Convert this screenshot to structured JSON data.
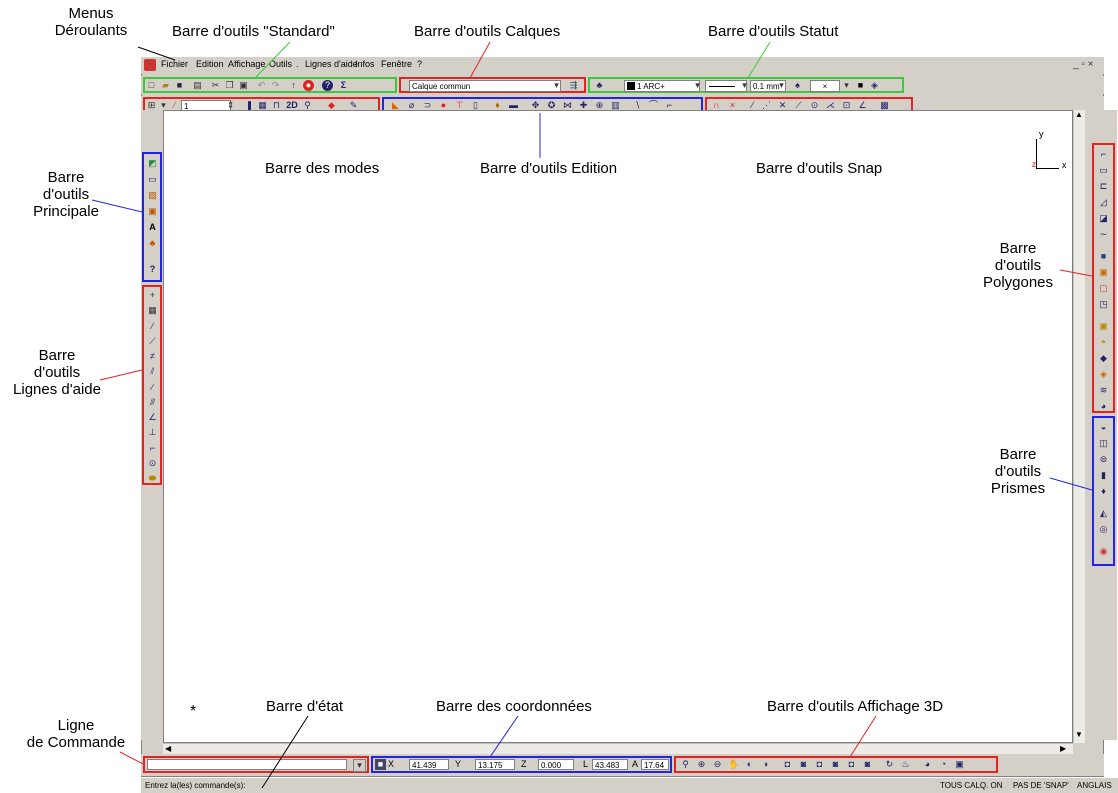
{
  "annotations": {
    "menus": "Menus\nDéroulants",
    "standard": "Barre d'outils \"Standard\"",
    "calques": "Barre d'outils Calques",
    "statut": "Barre d'outils Statut",
    "principale": "Barre\nd'outils\nPrincipale",
    "modes": "Barre des modes",
    "edition": "Barre d'outils Edition",
    "snap": "Barre d'outils Snap",
    "polygones": "Barre\nd'outils\nPolygones",
    "lignes_aide": "Barre\nd'outils\nLignes d'aide",
    "prismes": "Barre\nd'outils\nPrismes",
    "ligne_commande": "Ligne\nde Commande",
    "barre_etat": "Barre d'état",
    "coordonnees": "Barre des coordonnées",
    "affichage3d": "Barre d'outils Affichage 3D"
  },
  "menubar": {
    "items": [
      "Fichier",
      "Edition",
      "Affichage",
      "Outils",
      ".",
      "Lignes d'aide",
      "Infos",
      "Fenêtre",
      "?"
    ]
  },
  "window_controls": "_ ▫ ×",
  "layer_combo": "Calque commun",
  "status_toolbar": {
    "color_label": "1 ARC+",
    "linewidth": "0.1 mm"
  },
  "modes_toolbar": {
    "value": "1"
  },
  "coords": {
    "x_label": "X",
    "x_value": "41.439",
    "y_label": "Y",
    "y_value": "13.175",
    "z_label": "Z",
    "z_value": "0.000",
    "l_label": "L",
    "l_value": "43.483",
    "a_label": "A",
    "a_value": "17.64"
  },
  "axes_indicator": {
    "y": "y",
    "z": "z",
    "x": "x"
  },
  "cursor_mark": "*",
  "status_bar": {
    "prompt": "Entrez la(les) commande(s):",
    "calq": "TOUS CALQ. ON",
    "snap": "PAS DE 'SNAP'",
    "lang": "ANGLAIS"
  },
  "colors": {
    "red_group": "#e02424",
    "green_group": "#3cc93c",
    "blue_group": "#2424e0",
    "chrome": "#d4d0c8"
  }
}
